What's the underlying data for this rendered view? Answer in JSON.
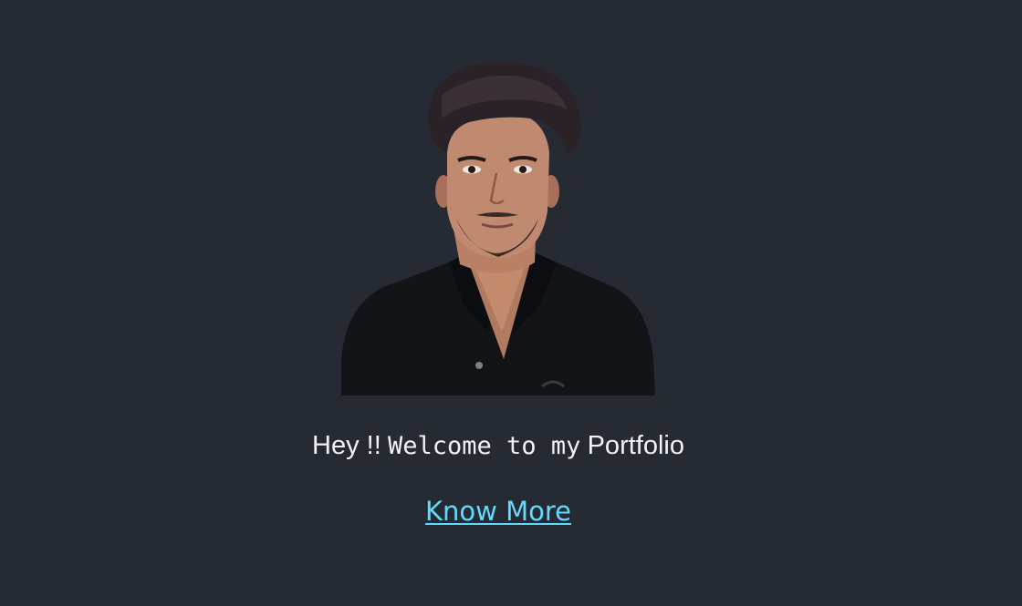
{
  "hero": {
    "greeting": "Hey !!",
    "welcome_text": "Welcome to my",
    "portfolio_word": "Portfolio",
    "cta_label": "Know More"
  },
  "colors": {
    "background": "#262a33",
    "text": "#f2f2f2",
    "link": "#61dafb"
  }
}
